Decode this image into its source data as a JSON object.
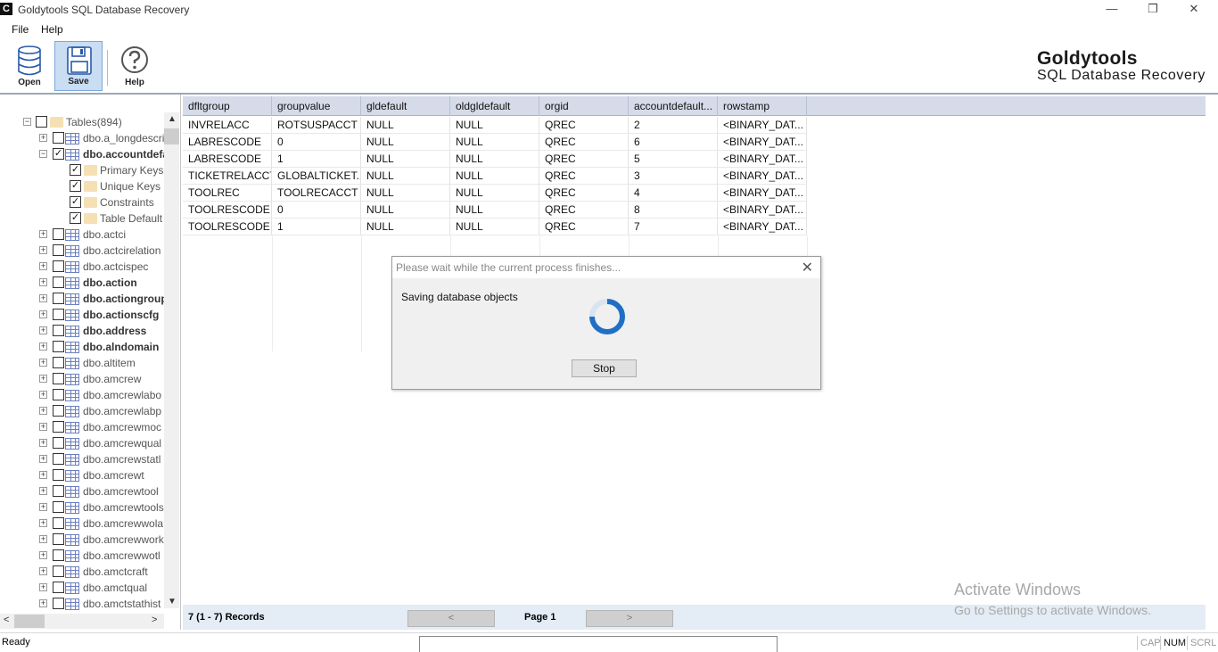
{
  "window": {
    "logo_letter": "C",
    "title": "Goldytools  SQL Database Recovery",
    "minimize": "—",
    "restore": "❐",
    "close": "✕"
  },
  "menu": [
    "File",
    "Help"
  ],
  "toolbar": {
    "open_label": "Open",
    "save_label": "Save",
    "help_label": "Help"
  },
  "brand": {
    "line1": "Goldytools",
    "line2": "SQL Database Recovery"
  },
  "tree": {
    "root_label": "Tables(894)",
    "items": [
      {
        "label": "dbo.a_longdescri",
        "bold": false,
        "checked": false
      },
      {
        "label": "dbo.accountdefa",
        "bold": true,
        "checked": true
      },
      {
        "label": "Primary Keys",
        "sub": true,
        "checked": true
      },
      {
        "label": "Unique Keys",
        "sub": true,
        "checked": true
      },
      {
        "label": "Constraints",
        "sub": true,
        "checked": true
      },
      {
        "label": "Table Default",
        "sub": true,
        "checked": true
      },
      {
        "label": "dbo.actci",
        "bold": false,
        "checked": false
      },
      {
        "label": "dbo.actcirelation",
        "bold": false,
        "checked": false
      },
      {
        "label": "dbo.actcispec",
        "bold": false,
        "checked": false
      },
      {
        "label": "dbo.action",
        "bold": true,
        "checked": false
      },
      {
        "label": "dbo.actiongroup",
        "bold": true,
        "checked": false
      },
      {
        "label": "dbo.actionscfg",
        "bold": true,
        "checked": false
      },
      {
        "label": "dbo.address",
        "bold": true,
        "checked": false
      },
      {
        "label": "dbo.alndomain",
        "bold": true,
        "checked": false
      },
      {
        "label": "dbo.altitem",
        "bold": false,
        "checked": false
      },
      {
        "label": "dbo.amcrew",
        "bold": false,
        "checked": false
      },
      {
        "label": "dbo.amcrewlabo",
        "bold": false,
        "checked": false
      },
      {
        "label": "dbo.amcrewlabp",
        "bold": false,
        "checked": false
      },
      {
        "label": "dbo.amcrewmoc",
        "bold": false,
        "checked": false
      },
      {
        "label": "dbo.amcrewqual",
        "bold": false,
        "checked": false
      },
      {
        "label": "dbo.amcrewstatl",
        "bold": false,
        "checked": false
      },
      {
        "label": "dbo.amcrewt",
        "bold": false,
        "checked": false
      },
      {
        "label": "dbo.amcrewtool",
        "bold": false,
        "checked": false
      },
      {
        "label": "dbo.amcrewtools",
        "bold": false,
        "checked": false
      },
      {
        "label": "dbo.amcrewwola",
        "bold": false,
        "checked": false
      },
      {
        "label": "dbo.amcrewwork",
        "bold": false,
        "checked": false
      },
      {
        "label": "dbo.amcrewwotl",
        "bold": false,
        "checked": false
      },
      {
        "label": "dbo.amctcraft",
        "bold": false,
        "checked": false
      },
      {
        "label": "dbo.amctqual",
        "bold": false,
        "checked": false
      },
      {
        "label": "dbo.amctstathist",
        "bold": false,
        "checked": false
      }
    ]
  },
  "grid": {
    "columns": [
      "dfltgroup",
      "groupvalue",
      "gldefault",
      "oldgldefault",
      "orgid",
      "accountdefault...",
      "rowstamp"
    ],
    "rows": [
      [
        "INVRELACC",
        "ROTSUSPACCT",
        "NULL",
        "NULL",
        "QREC",
        "2",
        "<BINARY_DAT..."
      ],
      [
        "LABRESCODE",
        "0",
        "NULL",
        "NULL",
        "QREC",
        "6",
        "<BINARY_DAT..."
      ],
      [
        "LABRESCODE",
        "1",
        "NULL",
        "NULL",
        "QREC",
        "5",
        "<BINARY_DAT..."
      ],
      [
        "TICKETRELACCT",
        "GLOBALTICKET...",
        "NULL",
        "NULL",
        "QREC",
        "3",
        "<BINARY_DAT..."
      ],
      [
        "TOOLREC",
        "TOOLRECACCT",
        "NULL",
        "NULL",
        "QREC",
        "4",
        "<BINARY_DAT..."
      ],
      [
        "TOOLRESCODE",
        "0",
        "NULL",
        "NULL",
        "QREC",
        "8",
        "<BINARY_DAT..."
      ],
      [
        "TOOLRESCODE",
        "1",
        "NULL",
        "NULL",
        "QREC",
        "7",
        "<BINARY_DAT..."
      ]
    ]
  },
  "pager": {
    "records": "7 (1 - 7) Records",
    "prev": "<",
    "page": "Page 1",
    "next": ">"
  },
  "dialog": {
    "title": "Please wait while the current process finishes...",
    "close": "✕",
    "message": "Saving database objects",
    "stop_label": "Stop"
  },
  "watermark": {
    "line1": "Activate Windows",
    "line2": "Go to Settings to activate Windows."
  },
  "status": {
    "text": "Ready",
    "indicators": [
      "CAP",
      "NUM",
      "SCRL"
    ]
  },
  "colors": {
    "accent": "#1f6fc5",
    "header_bg": "#d6dbe9",
    "pager_bg": "#e4ecf5"
  }
}
